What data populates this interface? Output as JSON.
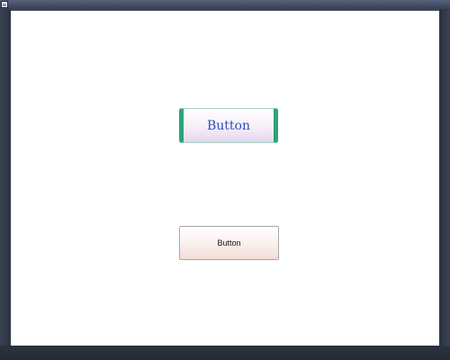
{
  "window": {
    "system_menu_icon": "window-icon"
  },
  "buttons": {
    "styled": {
      "label": "Button",
      "text_color": "#2a4fbf",
      "accent_color": "#2ea37a"
    },
    "plain": {
      "label": "Button"
    }
  },
  "colors": {
    "frame": "#2f3540",
    "client_background": "#ffffff"
  }
}
